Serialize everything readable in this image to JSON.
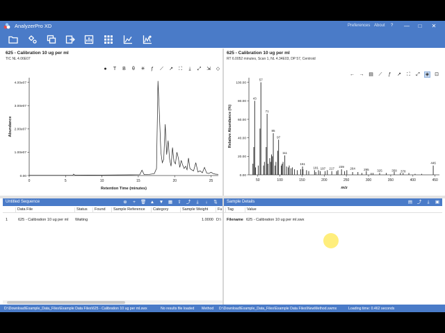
{
  "window": {
    "title": "AnalyzerPro XD",
    "menu_preferences": "Preferences",
    "menu_about": "About",
    "menu_help": "?",
    "minimize": "—",
    "maximize": "□",
    "close": "✕"
  },
  "toolbar": {
    "icons": [
      "open-folder-icon",
      "settings-icon",
      "copy-window-icon",
      "export-icon",
      "report-icon",
      "grid-icon",
      "chart-icon",
      "chart-analysis-icon"
    ]
  },
  "colors": {
    "accent": "#4a7bc8",
    "trace": "#222222"
  },
  "tic_pane": {
    "title": "625 - Calibration 10 ug per ml",
    "subtitle": "TIC NL 4.06E07",
    "tools": [
      "●",
      "T",
      "B",
      "θ",
      "✳",
      "ƒ",
      "⟋",
      "↗",
      "⛶",
      "⤓",
      "⤢",
      "⇲",
      "◇",
      "⊡"
    ]
  },
  "ms_pane": {
    "title": "625 - Calibration 10 ug per ml",
    "subtitle": "RT 6.0052 minutes, Scan 1, NL 4.34E03, DP 57, Centroid",
    "tools": [
      "←",
      "→",
      "▤",
      "⟋",
      "ƒ",
      "↗",
      "⛶",
      "⤢",
      "◈",
      "⊡"
    ]
  },
  "chart_data": [
    {
      "type": "line",
      "title": "",
      "xlabel": "Retention Time (minutes)",
      "ylabel": "Abundance",
      "xlim": [
        0,
        26
      ],
      "ylim": [
        0,
        42000000.0
      ],
      "xticks": [
        0,
        5,
        10,
        15,
        20,
        25
      ],
      "yticks": [
        0,
        10000000.0,
        20000000.0,
        30000000.0,
        40000000.0
      ],
      "ytick_labels": [
        "0.00",
        "1.00e07",
        "2.00e07",
        "3.00e07",
        "4.00e07"
      ],
      "grid": false,
      "series": [
        {
          "x": [
            0,
            3,
            6.0,
            6.1,
            6.3,
            10,
            14,
            15.2,
            15.5,
            15.8,
            16.5,
            17.2,
            17.5,
            17.7,
            17.9,
            18.1,
            18.3,
            18.5,
            18.7,
            18.9,
            19.1,
            19.3,
            19.5,
            19.7,
            19.9,
            20.1,
            20.3,
            20.5,
            20.7,
            20.9,
            21.1,
            21.3,
            21.5,
            21.7,
            21.9,
            22.1,
            22.3,
            22.6,
            22.9,
            23.2,
            23.5,
            23.8,
            24.1,
            24.4,
            24.7,
            25.0,
            25.3,
            25.6,
            26
          ],
          "y": [
            100000.0,
            100000.0,
            100000.0,
            600000.0,
            150000.0,
            200000.0,
            300000.0,
            350000.0,
            2300000.0,
            400000.0,
            500000.0,
            800000.0,
            3000000.0,
            40600000.0,
            26000000.0,
            10000000.0,
            5500000.0,
            7000000.0,
            22000000.0,
            9000000.0,
            15000000.0,
            7000000.0,
            4000000.0,
            12000000.0,
            6000000.0,
            5000000.0,
            10000000.0,
            7500000.0,
            3500000.0,
            6500000.0,
            4500000.0,
            3000000.0,
            4000000.0,
            2500000.0,
            7500000.0,
            3000000.0,
            2500000.0,
            2000000.0,
            5500000.0,
            1500000.0,
            2000000.0,
            1200000.0,
            3500000.0,
            1000000.0,
            900000.0,
            1400000.0,
            800000.0,
            600000.0,
            500000.0
          ]
        }
      ]
    },
    {
      "type": "bar",
      "title": "",
      "xlabel": "m/z",
      "ylabel": "Relative Abundance (%)",
      "xlim": [
        30,
        460
      ],
      "ylim": [
        0,
        105
      ],
      "xticks": [
        50,
        100,
        150,
        200,
        250,
        300,
        350,
        400,
        450
      ],
      "yticks": [
        0,
        20,
        40,
        60,
        80,
        100
      ],
      "ytick_labels": [
        "0.00",
        "20.00",
        "40.00",
        "60.00",
        "80.00",
        "100.00"
      ],
      "grid": false,
      "series": [
        {
          "x": [
            39,
            41,
            43,
            45,
            51,
            55,
            57,
            63,
            65,
            69,
            71,
            73,
            77,
            79,
            81,
            83,
            85,
            89,
            91,
            95,
            97,
            103,
            105,
            107,
            111,
            115,
            119,
            121,
            125,
            128,
            133,
            139,
            147,
            151,
            152,
            160,
            165,
            178,
            181,
            187,
            191,
            202,
            207,
            217,
            228,
            231,
            239,
            246,
            251,
            264,
            276,
            285,
            295,
            306,
            310,
            325,
            340,
            358,
            372,
            378,
            391,
            405,
            420,
            446
          ],
          "y": [
            12,
            30,
            80,
            8,
            10,
            50,
            100,
            10,
            14,
            30,
            66,
            12,
            18,
            14,
            22,
            20,
            45,
            10,
            14,
            26,
            38,
            10,
            12,
            14,
            21,
            9,
            8,
            10,
            7,
            8,
            6,
            5,
            6,
            9,
            6,
            5,
            4,
            5,
            3,
            5,
            4,
            4,
            5,
            4,
            4,
            5,
            6,
            4,
            5,
            3,
            3,
            2,
            4,
            2,
            2,
            2,
            2,
            3,
            2,
            2,
            2,
            1,
            1,
            10
          ]
        }
      ],
      "peak_labels": [
        {
          "mz": 43,
          "label": "43",
          "y": 80
        },
        {
          "mz": 57,
          "label": "57",
          "y": 100
        },
        {
          "mz": 71,
          "label": "71",
          "y": 66
        },
        {
          "mz": 85,
          "label": "85",
          "y": 45
        },
        {
          "mz": 97,
          "label": "97",
          "y": 38
        },
        {
          "mz": 111,
          "label": "111",
          "y": 21
        },
        {
          "mz": 151,
          "label": "151",
          "y": 9
        },
        {
          "mz": 181,
          "label": "181",
          "y": 5
        },
        {
          "mz": 197,
          "label": "197",
          "y": 4
        },
        {
          "mz": 217,
          "label": "217",
          "y": 4
        },
        {
          "mz": 239,
          "label": "239",
          "y": 6
        },
        {
          "mz": 264,
          "label": "264",
          "y": 4
        },
        {
          "mz": 295,
          "label": "295",
          "y": 3
        },
        {
          "mz": 325,
          "label": "325",
          "y": 2
        },
        {
          "mz": 358,
          "label": "358",
          "y": 2
        },
        {
          "mz": 378,
          "label": "378",
          "y": 1
        },
        {
          "mz": 446,
          "label": "446",
          "y": 10
        }
      ]
    }
  ],
  "sequence": {
    "title": "Untitled Sequence",
    "tools": [
      "⊕",
      "+",
      "🗑",
      "▲",
      "▼",
      "▦",
      "⇪",
      "⤴",
      "⤓",
      "↓",
      "⇅"
    ],
    "columns": [
      "Data File",
      "Status",
      "Found",
      "Sample Reference",
      "Category",
      "Sample Weight",
      "Fu"
    ],
    "rows": [
      {
        "index": "1",
        "data_file": "625 - Calibration 10 ug per ml",
        "status": "Waiting",
        "found": "",
        "sample_reference": "",
        "category": "",
        "sample_weight": "1.0000",
        "fu": "D:\\"
      }
    ]
  },
  "sample_details": {
    "title": "Sample Details",
    "tools": [
      "▤",
      "⤴",
      "⤓",
      "▣"
    ],
    "columns": [
      "Tag",
      "Value"
    ],
    "rows": [
      {
        "tag": "Filename",
        "value": "625 - Calibration 10 ug per ml.swx"
      }
    ]
  },
  "statusbar": {
    "path": "D:\\Download\\Example_Data_Files\\Example Data Files\\625 - Calibration 10 ug per ml.swx",
    "results": "No results file loaded",
    "method_label": "Method",
    "method": "D:\\Download\\Example_Data_Files\\Example Data Files\\NewMethod.swmx",
    "loading": "Loading time: 0.462 seconds"
  }
}
